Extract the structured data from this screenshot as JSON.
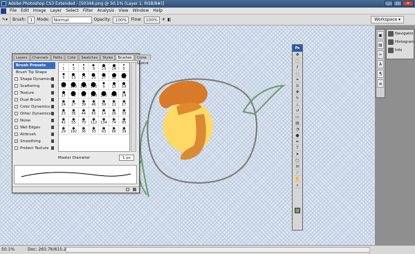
{
  "window": {
    "title": "Adobe Photoshop CS3 Extended - [50348.png @ 50.1% (Layer 1, RGB/8#)]"
  },
  "menu": [
    "File",
    "Edit",
    "Image",
    "Layer",
    "Select",
    "Filter",
    "Analysis",
    "View",
    "Window",
    "Help"
  ],
  "options": {
    "brush_label": "Brush:",
    "brush_size": "1",
    "mode_label": "Mode:",
    "mode_value": "Normal",
    "opacity_label": "Opacity:",
    "opacity_value": "100%",
    "flow_label": "Flow:",
    "flow_value": "100%",
    "workspace": "Workspace ▾"
  },
  "brushes_panel": {
    "tabs": [
      "Layers",
      "Channels",
      "Paths",
      "Color",
      "Swatches",
      "Styles",
      "Brushes ×",
      "Clone Source"
    ],
    "presets": "Brush Presets",
    "tip": "Brush Tip Shape",
    "options": [
      {
        "label": "Shape Dynamics",
        "checked": false
      },
      {
        "label": "Scattering",
        "checked": false
      },
      {
        "label": "Texture",
        "checked": false
      },
      {
        "label": "Dual Brush",
        "checked": false
      },
      {
        "label": "Color Dynamics",
        "checked": false
      },
      {
        "label": "Other Dynamics",
        "checked": false
      },
      {
        "label": "Noise",
        "checked": false
      },
      {
        "label": "Wet Edges",
        "checked": false
      },
      {
        "label": "Airbrush",
        "checked": false
      },
      {
        "label": "Smoothing",
        "checked": true
      },
      {
        "label": "Protect Texture",
        "checked": false
      }
    ],
    "brush_sizes": [
      "1",
      "3",
      "5",
      "9",
      "13",
      "19",
      "5",
      "9",
      "13",
      "17",
      "21",
      "27",
      "35",
      "45",
      "65",
      "100",
      "200",
      "300",
      "9",
      "13",
      "19",
      "17",
      "45",
      "65",
      "100",
      "200",
      "300",
      "14",
      "24",
      "27",
      "39",
      "46",
      "59",
      "11",
      "17",
      "23",
      "36",
      "44",
      "60",
      "14",
      "26",
      "33",
      "42",
      "55",
      "70",
      "112",
      "134",
      "74",
      "95",
      "29",
      "192",
      "36",
      "33",
      "63",
      "66",
      "39"
    ],
    "diameter_label": "Master Diameter",
    "diameter_value": "1 px"
  },
  "status": {
    "zoom": "50.1%",
    "doc": "Doc: 263.7K/615.2K"
  },
  "dock": {
    "items": [
      "Navigator",
      "Histogram",
      "Info"
    ]
  },
  "toolbox": {
    "header": "Ps",
    "tools": [
      "move",
      "marquee",
      "lasso",
      "quick-select",
      "crop",
      "slice",
      "heal",
      "brush",
      "stamp",
      "history",
      "eraser",
      "gradient",
      "blur",
      "dodge",
      "pen",
      "type",
      "path-select",
      "shape",
      "notes",
      "eyedropper",
      "hand",
      "zoom"
    ]
  },
  "colors": {
    "foreground": "#7a9c6a"
  }
}
